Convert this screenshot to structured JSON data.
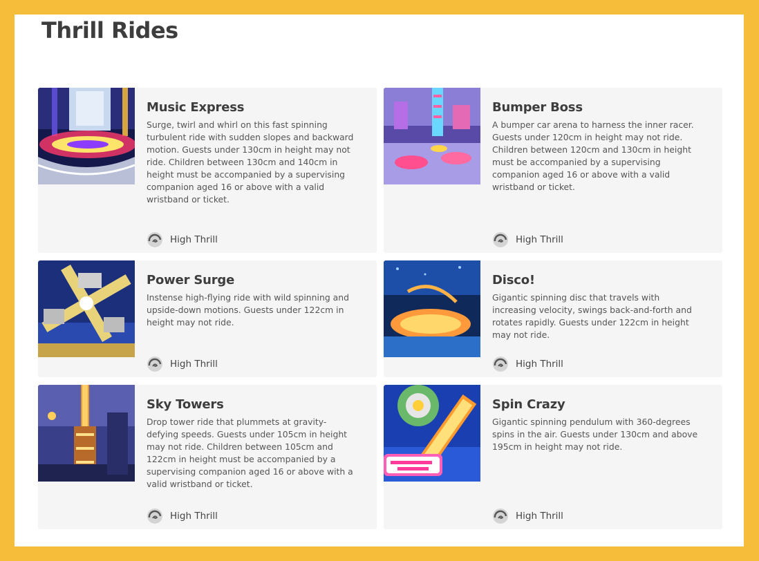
{
  "page": {
    "title": "Thrill Rides"
  },
  "colors": {
    "frame": "#f5bd3a",
    "card_bg": "#f5f5f5",
    "text": "#3d3d3d"
  },
  "rides": [
    {
      "name": "Music Express",
      "description": "Surge, twirl and whirl on this fast spinning turbulent ride with sudden slopes and backward motion. Guests under 130cm in height may not ride. Children between 130cm and 140cm in height must be accompanied by a supervising companion aged 16 or above with a valid wristband or ticket.",
      "tag": "High Thrill",
      "icon": "high-thrill-icon"
    },
    {
      "name": "Bumper Boss",
      "description": "A bumper car arena to harness the inner racer. Guests under 120cm in height may not ride. Children between 120cm and 130cm in height must be accompanied by a supervising companion aged 16 or above with a valid wristband or ticket.",
      "tag": "High Thrill",
      "icon": "high-thrill-icon"
    },
    {
      "name": "Power Surge",
      "description": "Instense high-flying ride with wild spinning and upside-down motions. Guests under 122cm in height may not ride.",
      "tag": "High Thrill",
      "icon": "high-thrill-icon"
    },
    {
      "name": "Disco!",
      "description": "Gigantic spinning disc that travels with increasing velocity, swings back-and-forth and rotates rapidly. Guests under 122cm in height may not ride.",
      "tag": "High Thrill",
      "icon": "high-thrill-icon"
    },
    {
      "name": "Sky Towers",
      "description": "Drop tower ride that plummets at gravity-defying speeds. Guests under 105cm in height may not ride. Children between 105cm and 122cm in height must be accompanied by a supervising companion aged 16 or above with a valid wristband or ticket.",
      "tag": "High Thrill",
      "icon": "high-thrill-icon"
    },
    {
      "name": "Spin Crazy",
      "description": "Gigantic spinning pendulum with 360-degrees spins in the air. Guests under 130cm and above 195cm in height may not ride.",
      "tag": "High Thrill",
      "icon": "high-thrill-icon"
    }
  ]
}
